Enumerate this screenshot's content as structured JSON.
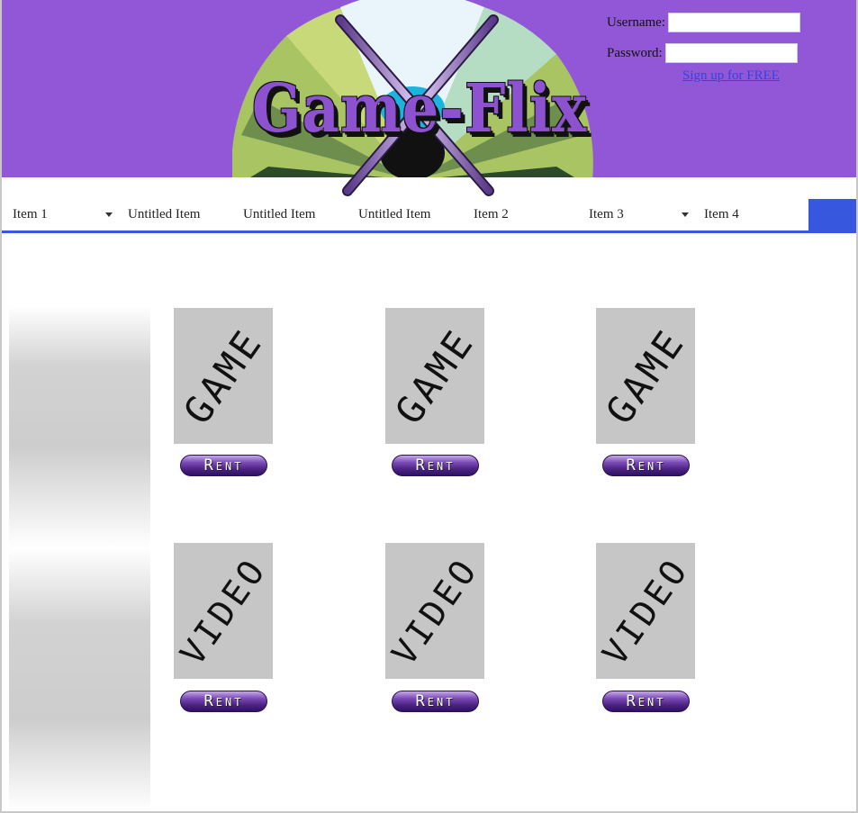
{
  "header": {
    "logo_text": "Game-Flix",
    "colors": {
      "background": "#9257d6",
      "accent": "#3857df",
      "disc_hub": "#1cb3dd"
    },
    "login": {
      "username_label": "Username:",
      "username_value": "",
      "password_label": "Password:",
      "password_value": "",
      "signup_link": "Sign up for FREE"
    }
  },
  "nav": {
    "items": [
      {
        "label": "Item 1",
        "has_dropdown": true
      },
      {
        "label": "Untitled Item",
        "has_dropdown": false
      },
      {
        "label": "Untitled Item",
        "has_dropdown": false
      },
      {
        "label": "Untitled Item",
        "has_dropdown": false
      },
      {
        "label": "Item 2",
        "has_dropdown": false
      },
      {
        "label": "Item 3",
        "has_dropdown": true
      },
      {
        "label": "Item 4",
        "has_dropdown": false
      }
    ]
  },
  "cards": {
    "games": [
      {
        "thumb_label": "GAME",
        "button_label": "Rent"
      },
      {
        "thumb_label": "GAME",
        "button_label": "Rent"
      },
      {
        "thumb_label": "GAME",
        "button_label": "Rent"
      }
    ],
    "videos": [
      {
        "thumb_label": "VIDEO",
        "button_label": "Rent"
      },
      {
        "thumb_label": "VIDEO",
        "button_label": "Rent"
      },
      {
        "thumb_label": "VIDEO",
        "button_label": "Rent"
      }
    ]
  }
}
